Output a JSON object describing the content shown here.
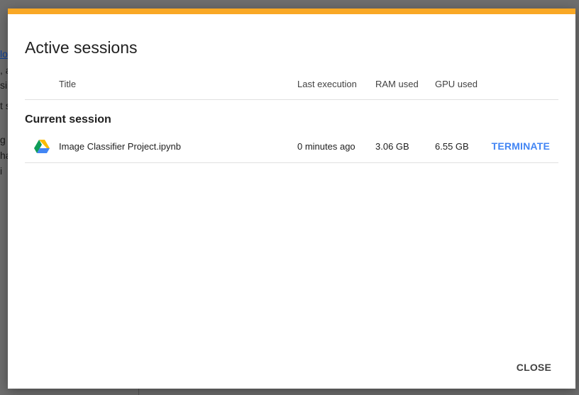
{
  "background": {
    "fragments": [
      "lo",
      ", a",
      "si",
      "t s",
      "g",
      "ha",
      " i"
    ]
  },
  "dialog": {
    "title": "Active sessions",
    "accent_color": "#f9a825",
    "columns": {
      "title": "Title",
      "last_execution": "Last execution",
      "ram_used": "RAM used",
      "gpu_used": "GPU used"
    },
    "section_heading": "Current session",
    "sessions": [
      {
        "icon": "google-drive-icon",
        "title": "Image Classifier Project.ipynb",
        "last_execution": "0 minutes ago",
        "ram_used": "3.06 GB",
        "gpu_used": "6.55 GB",
        "action_label": "TERMINATE"
      }
    ],
    "close_label": "CLOSE",
    "action_color": "#4285f4"
  }
}
